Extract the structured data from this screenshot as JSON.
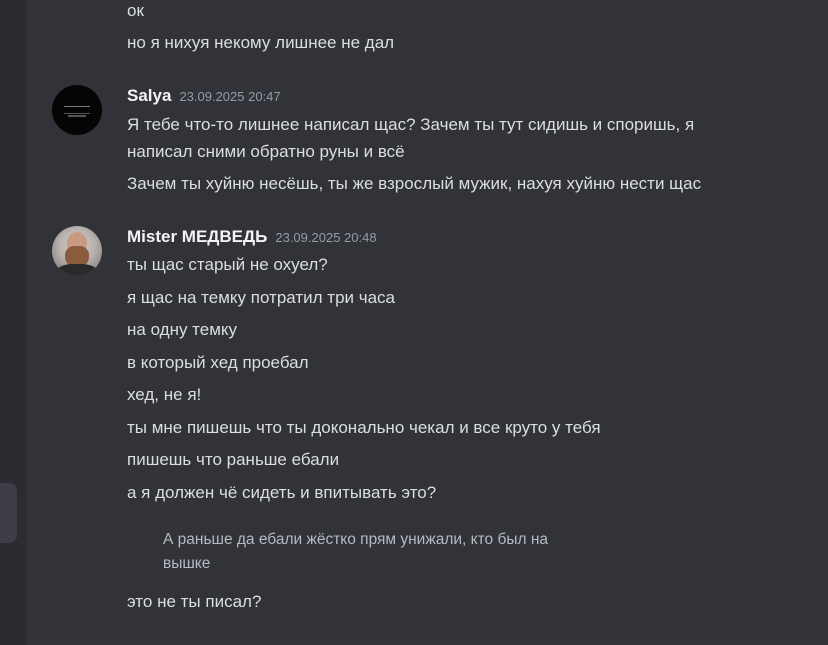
{
  "messages_top": [
    {
      "text": "ок"
    },
    {
      "text": "но я нихуя некому лишнее не дал"
    }
  ],
  "salya": {
    "username": "Salya",
    "timestamp": "23.09.2025 20:47",
    "lines": [
      "Я тебе что-то лишнее написал щас? Зачем ты тут сидишь и споришь, я",
      "написал сними обратно руны и всё",
      "Зачем ты хуйню несёшь, ты же взрослый мужик, нахуя хуйню нести щас"
    ]
  },
  "medved": {
    "username": "Mister МЕДВЕДЬ",
    "timestamp": "23.09.2025 20:48",
    "lines": [
      "ты щас старый не охуел?",
      "я щас на темку потратил три часа",
      "на одну темку",
      "в который хед проебал",
      "хед, не я!",
      "ты мне пишешь что ты доконально чекал и все круто у тебя",
      "пишешь что раньше ебали",
      "а я должен чё сидеть и впитывать это?"
    ],
    "quote_line_1": "А раньше да ебали жёстко прям унижали, кто был на",
    "quote_line_2": "вышке",
    "last_line": "это не ты писал?"
  }
}
